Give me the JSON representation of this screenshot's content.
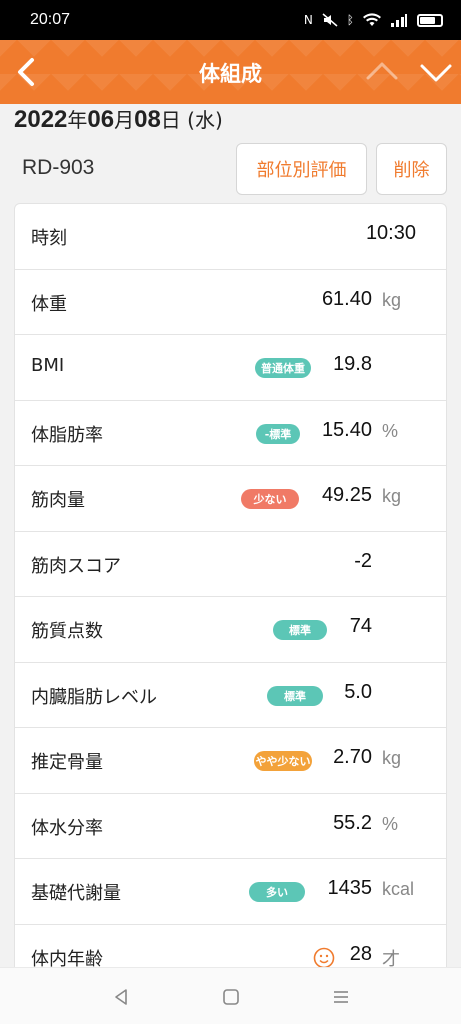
{
  "status_bar": {
    "time": "20:07"
  },
  "header": {
    "title": "体組成"
  },
  "date": {
    "year": "2022",
    "year_suffix": "年",
    "month": "06",
    "month_suffix": "月",
    "day": "08",
    "day_suffix": "日",
    "weekday": " (水)"
  },
  "device": {
    "name": "RD-903"
  },
  "actions": {
    "part_eval": "部位別評価",
    "delete": "削除"
  },
  "rows": [
    {
      "label": "時刻",
      "value": "10:30",
      "unit": "",
      "badge": ""
    },
    {
      "label": "体重",
      "value": "61.40",
      "unit": "kg",
      "badge": ""
    },
    {
      "label": "BMI",
      "value": "19.8",
      "unit": "",
      "badge": "普通体重",
      "badge_color": "#5cc6b6"
    },
    {
      "label": "体脂肪率",
      "value": "15.40",
      "unit": "%",
      "badge": "-標準",
      "badge_color": "#5cc6b6"
    },
    {
      "label": "筋肉量",
      "value": "49.25",
      "unit": "kg",
      "badge": "少ない",
      "badge_color": "#f07a66"
    },
    {
      "label": "筋肉スコア",
      "value": "-2",
      "unit": "",
      "badge": ""
    },
    {
      "label": "筋質点数",
      "value": "74",
      "unit": "",
      "badge": "標準",
      "badge_color": "#5cc6b6"
    },
    {
      "label": "内臓脂肪レベル",
      "value": "5.0",
      "unit": "",
      "badge": "標準",
      "badge_color": "#5cc6b6"
    },
    {
      "label": "推定骨量",
      "value": "2.70",
      "unit": "kg",
      "badge": "やや少ない",
      "badge_color": "#f3a23a"
    },
    {
      "label": "体水分率",
      "value": "55.2",
      "unit": "%",
      "badge": ""
    },
    {
      "label": "基礎代謝量",
      "value": "1435",
      "unit": "kcal",
      "badge": "多い",
      "badge_color": "#5cc6b6"
    },
    {
      "label": "体内年齢",
      "value": "28",
      "unit": "才",
      "badge": "",
      "icon": "face-icon"
    }
  ],
  "colors": {
    "accent": "#f07b2e",
    "teal": "#5cc6b6",
    "salmon": "#f07a66",
    "orange": "#f3a23a"
  }
}
